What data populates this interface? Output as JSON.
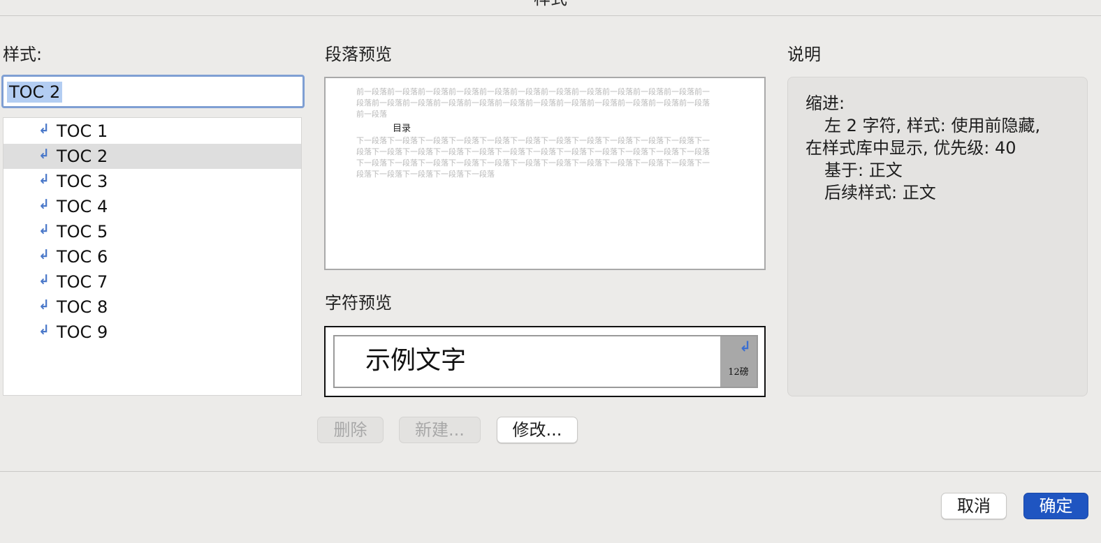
{
  "dialog": {
    "title": "样式"
  },
  "styles_section": {
    "label": "样式:",
    "name_value": "TOC 2",
    "items": [
      {
        "label": "TOC 1",
        "selected": false
      },
      {
        "label": "TOC 2",
        "selected": true
      },
      {
        "label": "TOC 3",
        "selected": false
      },
      {
        "label": "TOC 4",
        "selected": false
      },
      {
        "label": "TOC 5",
        "selected": false
      },
      {
        "label": "TOC 6",
        "selected": false
      },
      {
        "label": "TOC 7",
        "selected": false
      },
      {
        "label": "TOC 8",
        "selected": false
      },
      {
        "label": "TOC 9",
        "selected": false
      }
    ],
    "item_icon": "paragraph-return-icon",
    "item_glyph": "↲"
  },
  "paragraph_preview": {
    "label": "段落预览",
    "previous_text": "前一段落前一段落前一段落前一段落前一段落前一段落前一段落前一段落前一段落前一段落前一段落前一段落前一段落前一段落前一段落前一段落前一段落前一段落前一段落前一段落前一段落前一段落前一段落前一段落",
    "sample_text": "目录",
    "next_text": "下一段落下一段落下一段落下一段落下一段落下一段落下一段落下一段落下一段落下一段落下一段落下一段落下一段落下一段落下一段落下一段落下一段落下一段落下一段落下一段落下一段落下一段落下一段落下一段落下一段落下一段落下一段落下一段落下一段落下一段落下一段落下一段落下一段落下一段落下一段落下一段落下一段落下一段落下一段落"
  },
  "character_preview": {
    "label": "字符预览",
    "sample_text": "示例文字",
    "font_size": "12磅",
    "pilcrow": "↲"
  },
  "description": {
    "label": "说明",
    "lines": [
      "缩进:",
      "左  2 字符, 样式: 使用前隐藏,",
      "在样式库中显示, 优先级: 40",
      "基于: 正文",
      "后续样式: 正文"
    ]
  },
  "actions": {
    "delete": "删除",
    "new": "新建...",
    "modify": "修改..."
  },
  "footer": {
    "cancel": "取消",
    "ok": "确定"
  },
  "colors": {
    "accent": "#1f55c1",
    "selection": "#b3cdf2",
    "pilcrow": "#4a78c9"
  }
}
